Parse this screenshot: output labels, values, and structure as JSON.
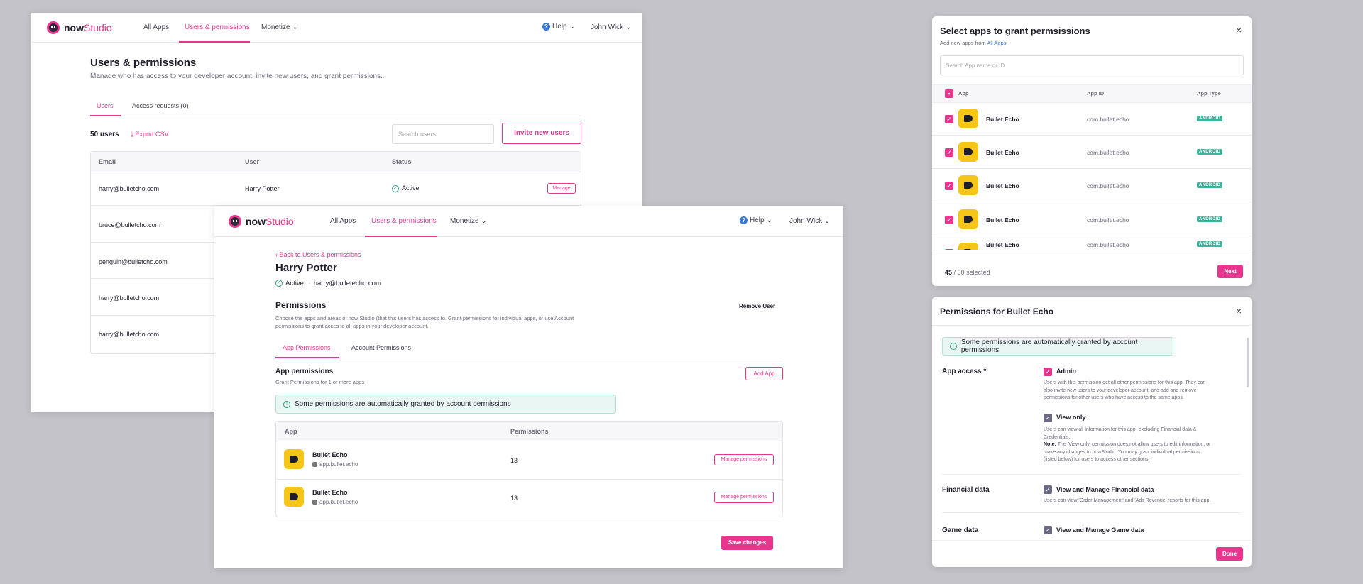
{
  "brand": {
    "now": "now",
    "studio": "Studio"
  },
  "nav": {
    "all_apps": "All Apps",
    "users_permissions": "Users & permissions",
    "monetize": "Monetize",
    "help": "Help",
    "user": "John Wick",
    "help_icon": "?",
    "chevron": "⌄"
  },
  "users_page": {
    "title": "Users & permissions",
    "subtitle": "Manage who has access to your developer account, invite new users, and grant permissions.",
    "tab_users": "Users",
    "tab_access": "Access requests (0)",
    "count": "50 users",
    "export": "Export CSV",
    "search_placeholder": "Search users",
    "invite": "Invite new users",
    "col_email": "Email",
    "col_user": "User",
    "col_status": "Status",
    "rows": [
      {
        "email": "harry@bulletcho.com",
        "user": "Harry Potter",
        "status": "Active",
        "action": "Manage"
      },
      {
        "email": "bruce@bulletcho.com"
      },
      {
        "email": "penguin@bulletcho.com"
      },
      {
        "email": "harry@bulletcho.com"
      },
      {
        "email": "harry@bulletcho.com"
      }
    ]
  },
  "user_detail": {
    "back": "Back to Users & permissions",
    "name": "Harry Potter",
    "status": "Active",
    "email": "harry@bulletecho.com",
    "perm_title": "Permissions",
    "remove": "Remove User",
    "perm_desc_1": "Choose  the apps and areas of now Studio (that this users has access to. Grant permissions for individual apps, or use Account",
    "perm_desc_2": "permissions to grant  acces to all apps in your developer account.",
    "tab_app": "App Permissions",
    "tab_account": "Account Permissions",
    "app_perm_title": "App permissions",
    "app_perm_sub": "Grant Permissions for 1 or more apps",
    "add_app": "Add App",
    "info": "Some permissions are automatically granted by account permissions",
    "col_app": "App",
    "col_perms": "Permissions",
    "apps": [
      {
        "name": "Bullet Echo",
        "id": "app.bullet.echo",
        "perms": "13",
        "action": "Manage permissions"
      },
      {
        "name": "Bullet Echo",
        "id": "app.bullet.echo",
        "perms": "13",
        "action": "Manage permissions"
      }
    ],
    "save": "Save changes"
  },
  "select_apps": {
    "title": "Select apps to grant permsissions",
    "sub_prefix": "Add new apps from ",
    "sub_link": "All Apps",
    "search_placeholder": "Search App name or ID",
    "col_app": "App",
    "col_id": "App ID",
    "col_type": "App Type",
    "rows": [
      {
        "name": "Bullet Echo",
        "id": "com.bullet.echo",
        "type": "ANDROID"
      },
      {
        "name": "Bullet Echo",
        "id": "com.bullet.echo",
        "type": "ANDROID"
      },
      {
        "name": "Bullet Echo",
        "id": "com.bullet.echo",
        "type": "ANDROID"
      },
      {
        "name": "Bullet Echo",
        "id": "com.bullet.echo",
        "type": "ANDROID"
      },
      {
        "name": "Bullet Echo",
        "id": "com.bullet.echo",
        "type": "ANDROID"
      }
    ],
    "selected_count": "45",
    "selected_total": "/ 50",
    "selected_word": "selected",
    "next": "Next",
    "close": "×"
  },
  "perm_modal": {
    "title": "Permissions for Bullet Echo",
    "info": "Some permissions are automatically granted by account permissions",
    "app_access": "App access *",
    "admin": "Admin",
    "admin_desc_1": "Users with this permission get all other permissions for this app. They can",
    "admin_desc_2": "also invite new users to your developer account, and add and remove",
    "admin_desc_3": "permissions for other users who have access to the same apps.",
    "view_only": "View only",
    "view_desc_1": "Users can view all information for this app- excluding Financial data &",
    "view_desc_2": "Credentials.",
    "note_label": "Note:",
    "note_1": " The 'View only' permission does not allow users to edit information, or",
    "note_2": "make any changes to nowStudio. You may grant individual permissions",
    "note_3": "(listed below) for users to access other sections.",
    "financial": "Financial data",
    "financial_opt": "View and Manage Financial data",
    "financial_desc": "Users can view 'Order Management' and 'Ads Revenue' reports for this app.",
    "game": "Game data",
    "game_opt": "View and Manage Game data",
    "done": "Done",
    "close": "×"
  },
  "colors": {
    "accent": "#e8368f",
    "success": "#2f9e86",
    "android": "#3cb39a"
  }
}
